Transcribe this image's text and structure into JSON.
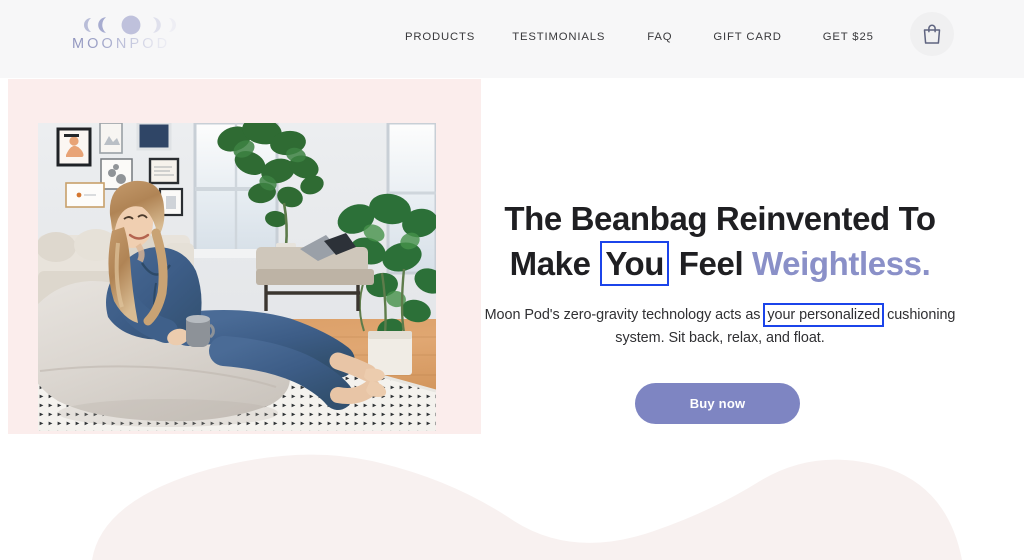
{
  "header": {
    "logo": {
      "wordmark": "MOONPOD",
      "icon_name": "moon-phases-icon"
    },
    "nav": [
      {
        "label": "PRODUCTS",
        "gap": 0
      },
      {
        "label": "TESTIMONIALS",
        "gap": 37
      },
      {
        "label": "FAQ",
        "gap": 42
      },
      {
        "label": "GIFT CARD",
        "gap": 41
      },
      {
        "label": "GET $25",
        "gap": 41
      }
    ],
    "cart": {
      "icon_name": "shopping-bag-icon"
    }
  },
  "hero": {
    "image": {
      "alt": "Woman in denim jumpsuit reclining on a grey Moon Pod beanbag in a plant-filled living room"
    },
    "headline": {
      "line1": "The Beanbag Reinvented To",
      "line2_a": "Make ",
      "line2_boxed": "You",
      "line2_b": " Feel ",
      "line2_accent": "Weightless."
    },
    "subcopy": {
      "part1": "Moon Pod's zero-gravity technology acts as ",
      "boxed": "your personalized",
      "part2": " cushioning system. Sit back, relax, and float."
    },
    "cta": {
      "label": "Buy now"
    }
  },
  "colors": {
    "accent_purple": "#8a90c8",
    "button_purple": "#7e85c2",
    "pink_panel": "#fbedec",
    "header_bg": "#f7f7f8",
    "annotation_blue": "#1b44ea",
    "text_dark": "#1f1f22"
  }
}
